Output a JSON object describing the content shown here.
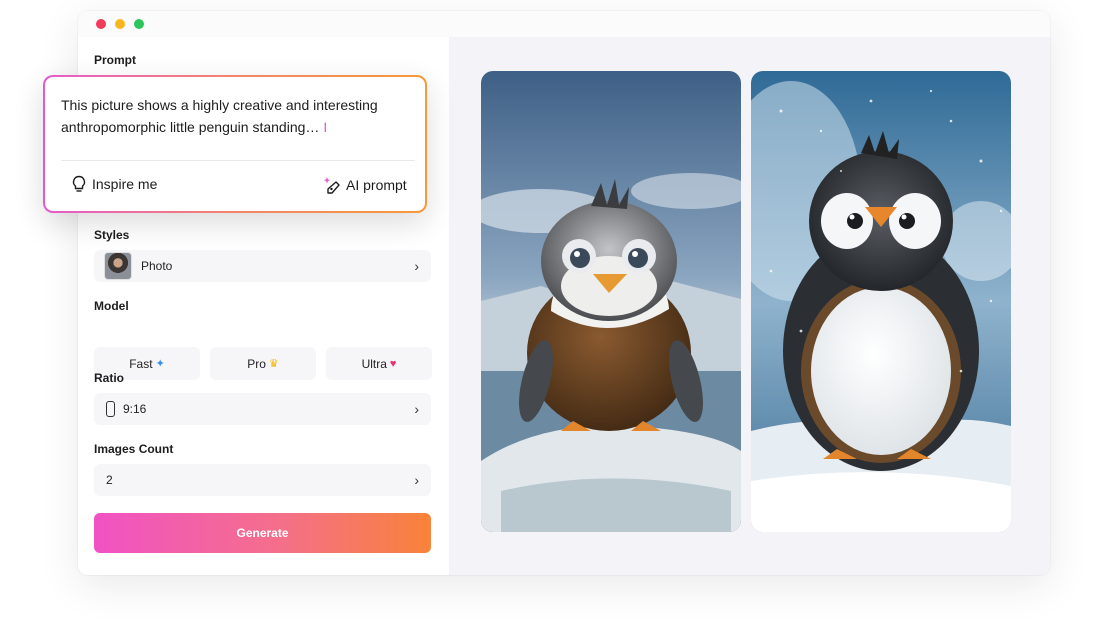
{
  "prompt": {
    "label": "Prompt",
    "text": "This picture shows a highly creative and interesting anthropomorphic little penguin standing…",
    "inspire_label": "Inspire me",
    "ai_prompt_label": "AI prompt"
  },
  "styles": {
    "label": "Styles",
    "value": "Photo"
  },
  "model": {
    "label": "Model",
    "options": [
      {
        "label": "Fast",
        "icon": "puzzle-icon"
      },
      {
        "label": "Pro",
        "icon": "crown-icon"
      },
      {
        "label": "Ultra",
        "icon": "heart-icon"
      }
    ]
  },
  "ratio": {
    "label": "Ratio",
    "value": "9:16"
  },
  "images_count": {
    "label": "Images Count",
    "value": "2"
  },
  "generate_label": "Generate",
  "colors": {
    "generate_gradient": [
      "#f152c4",
      "#f46f8a",
      "#f88339"
    ],
    "close": "#f23b5c",
    "minimize": "#f6b620",
    "maximize": "#2bc65a"
  }
}
